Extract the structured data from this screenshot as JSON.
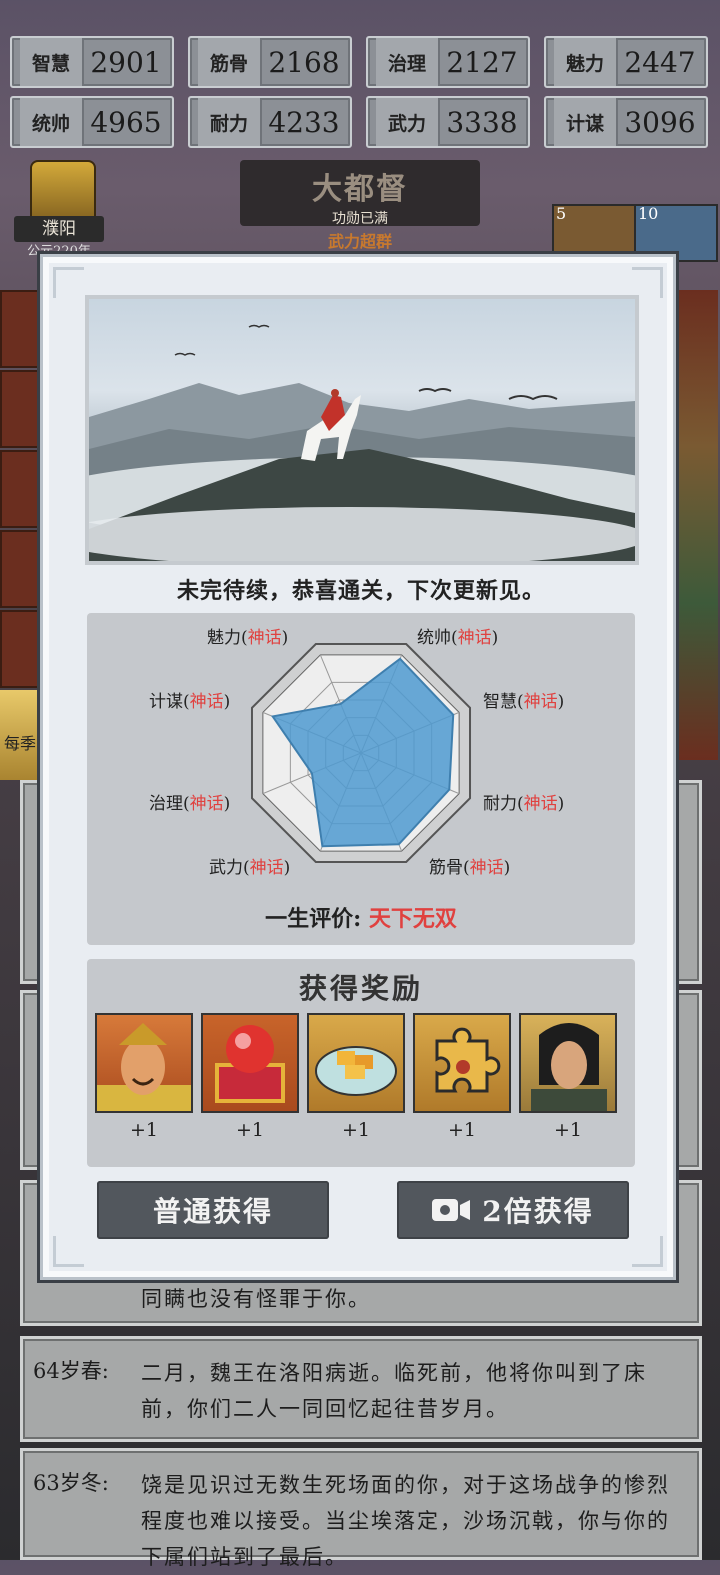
{
  "stats": [
    {
      "label": "智慧",
      "value": "2901"
    },
    {
      "label": "筋骨",
      "value": "2168"
    },
    {
      "label": "治理",
      "value": "2127"
    },
    {
      "label": "魅力",
      "value": "2447"
    },
    {
      "label": "统帅",
      "value": "4965"
    },
    {
      "label": "耐力",
      "value": "4233"
    },
    {
      "label": "武力",
      "value": "3338"
    },
    {
      "label": "计谋",
      "value": "3096"
    }
  ],
  "rank": {
    "title": "大都督",
    "subtitle": "功勋已满",
    "tag": "武力超群"
  },
  "city": {
    "name": "濮阳",
    "year": "公元220年"
  },
  "side_labels": {
    "left_caption": "每季",
    "top_badge_a": "5",
    "top_badge_b": "10"
  },
  "modal": {
    "message": "未完待续，恭喜通关，下次更新见。",
    "radar": {
      "axes": [
        {
          "name": "统帅",
          "grade": "神话"
        },
        {
          "name": "智慧",
          "grade": "神话"
        },
        {
          "name": "耐力",
          "grade": "神话"
        },
        {
          "name": "筋骨",
          "grade": "神话"
        },
        {
          "name": "武力",
          "grade": "神话"
        },
        {
          "name": "治理",
          "grade": "神话"
        },
        {
          "name": "计谋",
          "grade": "神话"
        },
        {
          "name": "魅力",
          "grade": "神话"
        }
      ],
      "levels": [
        0.96,
        0.94,
        0.9,
        0.93,
        0.95,
        0.5,
        0.9,
        0.5
      ]
    },
    "evaluation_label": "一生评价:",
    "evaluation_result": "天下无双",
    "rewards_title": "获得奖励",
    "rewards": [
      {
        "icon": "general-portrait-icon",
        "count": "+1"
      },
      {
        "icon": "red-orb-chest-icon",
        "count": "+1"
      },
      {
        "icon": "gold-ingot-plate-icon",
        "count": "+1"
      },
      {
        "icon": "puzzle-piece-icon",
        "count": "+1"
      },
      {
        "icon": "young-hero-portrait-icon",
        "count": "+1"
      }
    ],
    "btn_normal": "普通获得",
    "btn_double": "2倍获得"
  },
  "log": [
    {
      "age": "",
      "text": "同瞒也没有怪罪于你。"
    },
    {
      "age": "64岁春:",
      "text": "二月，魏王在洛阳病逝。临死前，他将你叫到了床前，你们二人一同回忆起往昔岁月。"
    },
    {
      "age": "63岁冬:",
      "text": "饶是见识过无数生死场面的你，对于这场战争的惨烈程度也难以接受。当尘埃落定，沙场沉戟，你与你的下属们站到了最后。"
    }
  ],
  "colors": {
    "accent_red": "#e0413f",
    "radar_fill": "#4f9ad0",
    "button": "#52575d"
  }
}
